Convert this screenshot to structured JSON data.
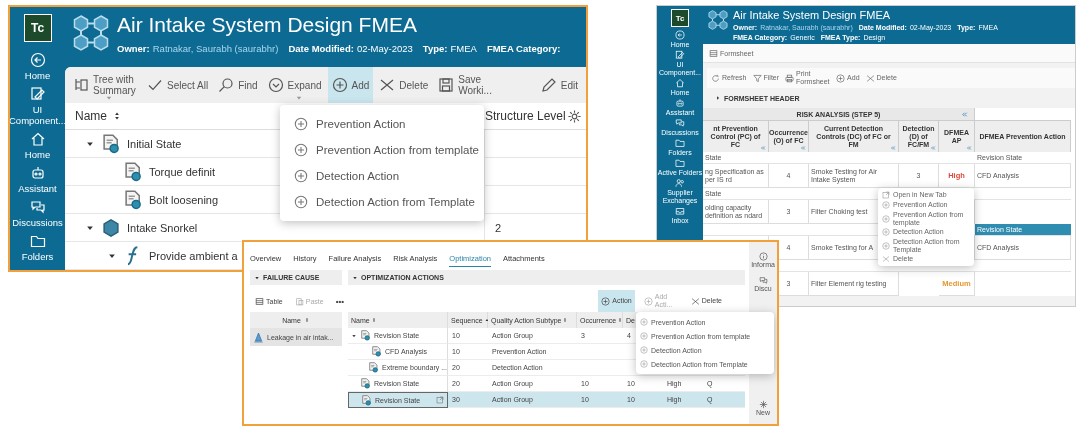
{
  "main_window": {
    "logo": "Tc",
    "title": "Air Intake System Design FMEA",
    "meta": [
      {
        "label": "Owner:",
        "value": "Ratnakar, Saurabh (saurabhr)",
        "kind": "link"
      },
      {
        "label": "Date Modified:",
        "value": "02-May-2023",
        "kind": "plain"
      },
      {
        "label": "Type:",
        "value": "FMEA",
        "kind": "plain"
      },
      {
        "label": "FMEA Category:"
      }
    ],
    "sidebar": [
      "Home",
      "UI Component...",
      "Home",
      "Assistant",
      "Discussions",
      "Folders"
    ],
    "toolbar": [
      {
        "label": "Tree with Summary",
        "dropdown": true,
        "pressed": false
      },
      {
        "label": "Select All",
        "dropdown": false,
        "pressed": false
      },
      {
        "label": "Find",
        "dropdown": false,
        "pressed": false
      },
      {
        "label": "Expand",
        "dropdown": true,
        "pressed": false
      },
      {
        "label": "Add",
        "dropdown": false,
        "pressed": true
      },
      {
        "label": "Delete",
        "dropdown": false,
        "pressed": false
      },
      {
        "label": "Save Worki...",
        "dropdown": false,
        "pressed": false
      }
    ],
    "edit_button": "Edit",
    "columns": [
      "Name",
      "Structure Level"
    ],
    "rows": [
      {
        "name": "Initial State",
        "kind": "state",
        "expanded": true,
        "children": [
          {
            "name": "Torque definit",
            "kind": "state"
          },
          {
            "name": "Bolt loosening",
            "kind": "state"
          }
        ]
      },
      {
        "name": "Intake Snorkel",
        "kind": "component",
        "structure_level": "2",
        "expanded": true,
        "children": [
          {
            "name": "Provide ambient a",
            "kind": "function",
            "expanded": true
          }
        ]
      }
    ],
    "add_menu": [
      "Prevention Action",
      "Prevention Action from template",
      "Detection Action",
      "Detection Action from Template"
    ]
  },
  "right_window": {
    "logo": "Tc",
    "title": "Air Intake System Design FMEA",
    "meta": [
      {
        "label": "Owner:",
        "value": "Ratnakar, Saurabh (saurabhr)",
        "kind": "link"
      },
      {
        "label": "Date Modified:",
        "value": "02-May-2023",
        "kind": "plain"
      },
      {
        "label": "Type:",
        "value": "FMEA",
        "kind": "plain"
      },
      {
        "label": "FMEA Category:",
        "value": "Generic",
        "kind": "plain"
      },
      {
        "label": "FMEA Type:",
        "value": "Design",
        "kind": "plain"
      }
    ],
    "sidebar": [
      "Home",
      "UI Component...",
      "Home",
      "Assistant",
      "Discussions",
      "Folders",
      "Active Folders",
      "Supplier Exchanges",
      "Inbox"
    ],
    "view_button": "Formsheet",
    "toolbar": [
      "Refresh",
      "Filter",
      "Print Formsheet",
      "Add",
      "Delete"
    ],
    "section": "FORMSHEET HEADER",
    "group_header": "RISK ANALYSIS (STEP 5)",
    "columns": [
      "nt Prevention Control (PC) of FC",
      "Occurrence (O) of FC",
      "Current Detection Controls (DC) of FC or FM",
      "Detection (D) of FC/FM",
      "DFMEA AP",
      "DFMEA Prevention Action"
    ],
    "rows": [
      {
        "kind": "group",
        "label": "State",
        "action": "Revision State",
        "selected": false
      },
      {
        "kind": "data",
        "control": "ng Specification as per IS rd",
        "occurrence": "4",
        "detection_controls": "Smoke Testing for Air Intake System",
        "detection": "3",
        "ap": "High",
        "color": "#e0473c",
        "action": "CFD Analysis",
        "selected": false
      },
      {
        "kind": "group",
        "label": "State",
        "selected": false
      },
      {
        "kind": "data",
        "control": "olding capacity definition as ndard",
        "occurrence": "3",
        "detection_controls": "Filter Choking test",
        "selected": false
      },
      {
        "kind": "group",
        "action": "Revision State",
        "selected": true
      },
      {
        "kind": "data",
        "occurrence": "4",
        "detection_controls": "Smoke Testing for A",
        "action": "CFD Analysis",
        "selected": false
      },
      {
        "kind": "group",
        "selected": false
      },
      {
        "kind": "data",
        "occurrence": "3",
        "detection_controls": "Filter Element rig testing",
        "ap": "Medium",
        "color": "#e8962e",
        "selected": false
      }
    ],
    "context_menu": [
      "Open in New Tab",
      "Prevention Action",
      "Prevention Action from template",
      "Detection Action",
      "Detection Action from Template",
      "Delete"
    ]
  },
  "detail_window": {
    "tabs": [
      {
        "label": "Overview",
        "selected": false
      },
      {
        "label": "History",
        "selected": false
      },
      {
        "label": "Failure Analysis",
        "selected": false
      },
      {
        "label": "Risk Analysis",
        "selected": false
      },
      {
        "label": "Optimization",
        "selected": true
      },
      {
        "label": "Attachments",
        "selected": false
      }
    ],
    "failure_cause": {
      "title": "FAILURE CAUSE",
      "toolbar": [
        {
          "label": "Table",
          "disabled": false
        },
        {
          "label": "Paste",
          "disabled": true
        }
      ],
      "more": "•••",
      "column": "Name",
      "rows": [
        {
          "name": "Leakage in air intak...",
          "selected": true
        }
      ]
    },
    "optimization": {
      "title": "OPTIMIZATION ACTIONS",
      "toolbar": [
        {
          "label": "Action",
          "pressed": true,
          "disabled": false
        },
        {
          "label": "Add Acti...",
          "pressed": false,
          "disabled": true
        },
        {
          "label": "Delete",
          "pressed": false,
          "disabled": false
        }
      ],
      "columns": [
        "Name",
        "Sequence",
        "Quality Action Subtype",
        "Occurrence",
        "De"
      ],
      "rows": [
        {
          "name": "Revision State",
          "values": [
            "10",
            "Action Group",
            "3",
            "4"
          ],
          "expanded": true,
          "selected": false,
          "children": [
            {
              "name": "CFD Analysis",
              "values": [
                "10",
                "Prevention Action"
              ],
              "selected": false
            },
            {
              "name": "Extreme boundary ...",
              "values": [
                "20",
                "Detection Action"
              ],
              "selected": false
            }
          ]
        },
        {
          "name": "Revision State",
          "values": [
            "20",
            "Action Group",
            "10",
            "10",
            "High",
            "Q"
          ],
          "selected": false
        },
        {
          "name": "Revision State",
          "values": [
            "30",
            "Action Group",
            "10",
            "10",
            "High",
            "Q"
          ],
          "selected": true
        }
      ],
      "menu": [
        "Prevention Action",
        "Prevention Action from template",
        "Detection Action",
        "Detection Action from Template"
      ]
    },
    "rail": [
      "Informa",
      "Discu",
      "New"
    ]
  }
}
